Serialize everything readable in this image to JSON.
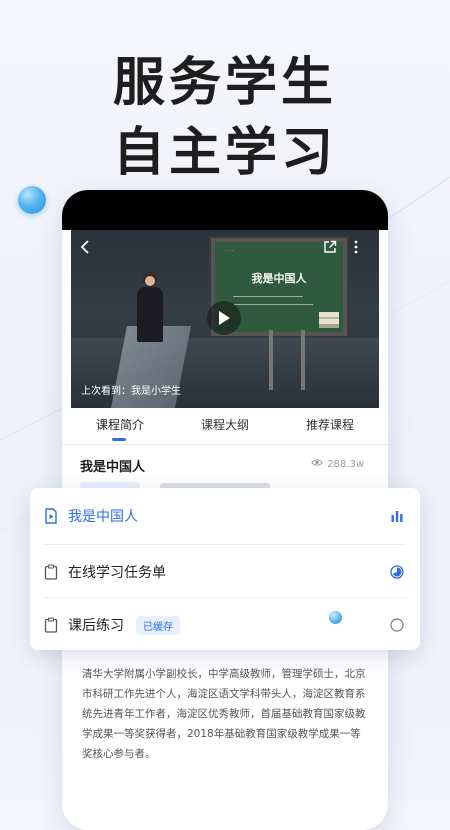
{
  "headline": {
    "line1": "服务学生",
    "line2": "自主学习"
  },
  "colors": {
    "accent": "#2f6ee6",
    "background": "#f2f4f9",
    "text": "#222222",
    "muted": "#999999"
  },
  "video": {
    "board_title": "我是中国人",
    "last_seen": "上次看到：我是小学生",
    "icons": {
      "back": "back-arrow-icon",
      "share": "share-icon",
      "more": "more-vertical-icon",
      "play": "play-icon"
    }
  },
  "tabs": [
    {
      "label": "课程简介",
      "active": true
    },
    {
      "label": "课程大纲",
      "active": false
    },
    {
      "label": "推荐课程",
      "active": false
    }
  ],
  "course": {
    "title": "我是中国人",
    "views": "288.3w"
  },
  "outline_card": {
    "items": [
      {
        "label": "我是中国人",
        "icon": "video-file-icon",
        "status_icon": "bar-chart-icon",
        "active": true
      },
      {
        "label": "在线学习任务单",
        "icon": "clipboard-icon",
        "status_icon": "progress-circle-icon",
        "active": false
      },
      {
        "label": "课后练习",
        "icon": "clipboard-icon",
        "badge": "已缓存",
        "status_icon": "empty-circle-icon",
        "active": false
      }
    ]
  },
  "teacher_intro": {
    "description": "清华大学附属小学副校长，中学高级教师，管理学硕士，北京市科研工作先进个人，海淀区语文学科带头人，海淀区教育系统先进青年工作者，海淀区优秀教师，首届基础教育国家级教学成果一等奖获得者，2018年基础教育国家级教学成果一等奖核心参与者。"
  }
}
